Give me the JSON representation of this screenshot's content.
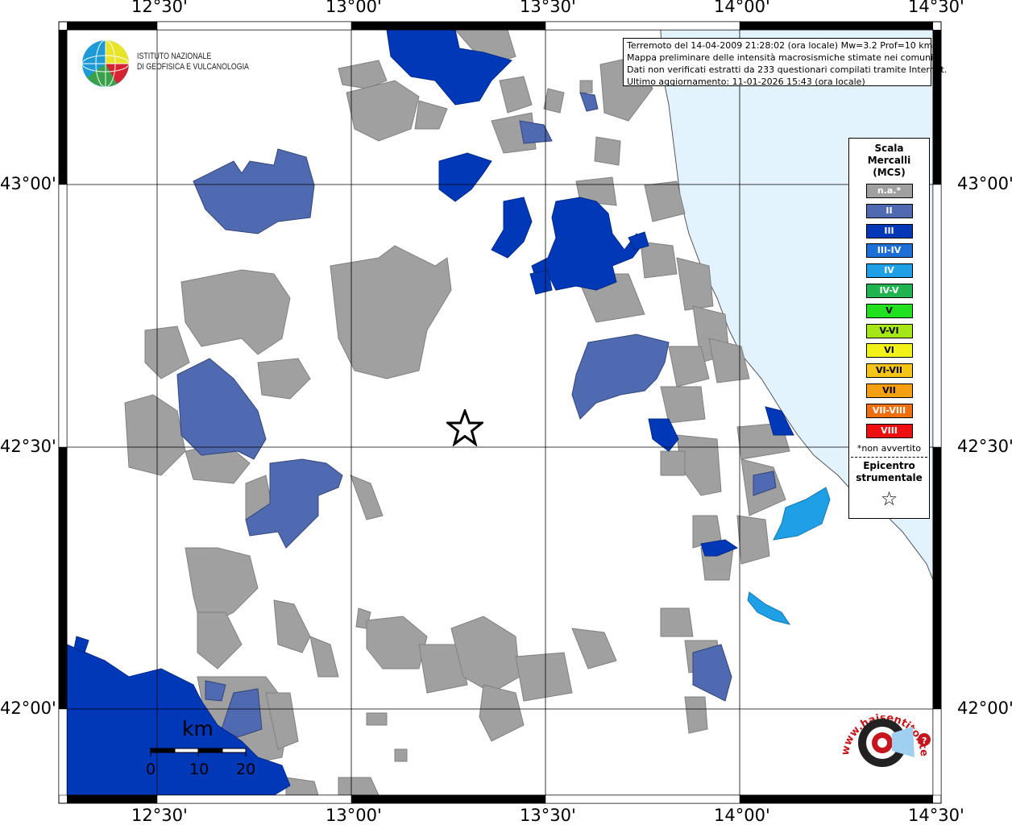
{
  "map": {
    "lon_labels": [
      "12°30'",
      "13°00'",
      "13°30'",
      "14°00'",
      "14°30'"
    ],
    "lat_labels": [
      "43°00'",
      "42°30'",
      "42°00'"
    ],
    "info_lines": [
      "Terremoto del 14-04-2009 21:28:02 (ora locale) Mw=3.2 Prof=10 km",
      "Mappa preliminare delle intensità macrosismiche stimate nei comuni",
      "Dati non verificati estratti da 233 questionari compilati tramite Internet.",
      "Ultimo aggiornamento: 11-01-2026 15:43 (ora locale)"
    ],
    "logo_lines": [
      "ISTITUTO NAZIONALE",
      "DI GEOFISICA E VULCANOLOGIA"
    ],
    "legend": {
      "title": [
        "Scala",
        "Mercalli",
        "(MCS)"
      ],
      "items": [
        {
          "label": "n.a.*",
          "color": "#a0a0a0"
        },
        {
          "label": "II",
          "color": "#4f6ab0"
        },
        {
          "label": "III",
          "color": "#0038b8"
        },
        {
          "label": "III-IV",
          "color": "#1e6ed8"
        },
        {
          "label": "IV",
          "color": "#1fa0e6"
        },
        {
          "label": "IV-V",
          "color": "#1fb450"
        },
        {
          "label": "V",
          "color": "#20e020"
        },
        {
          "label": "V-VI",
          "color": "#a6e617"
        },
        {
          "label": "VI",
          "color": "#f2f21a"
        },
        {
          "label": "VI-VII",
          "color": "#f5c418"
        },
        {
          "label": "VII",
          "color": "#f5a010"
        },
        {
          "label": "VII-VIII",
          "color": "#f07010"
        },
        {
          "label": "VIII",
          "color": "#ee1010"
        }
      ],
      "note": "*non avvertito",
      "epicenter_title": [
        "Epicentro",
        "strumentale"
      ]
    },
    "scale": {
      "unit": "km",
      "ticks": [
        "0",
        "10",
        "20"
      ]
    },
    "watermark_text": "www.haisentitoilterremoto.it",
    "colors": {
      "sea": "#e3f3fd",
      "not_felt": "#a0a0a0",
      "II": "#4f6ab0",
      "III": "#0038b8",
      "IV": "#1fa0e6"
    }
  }
}
